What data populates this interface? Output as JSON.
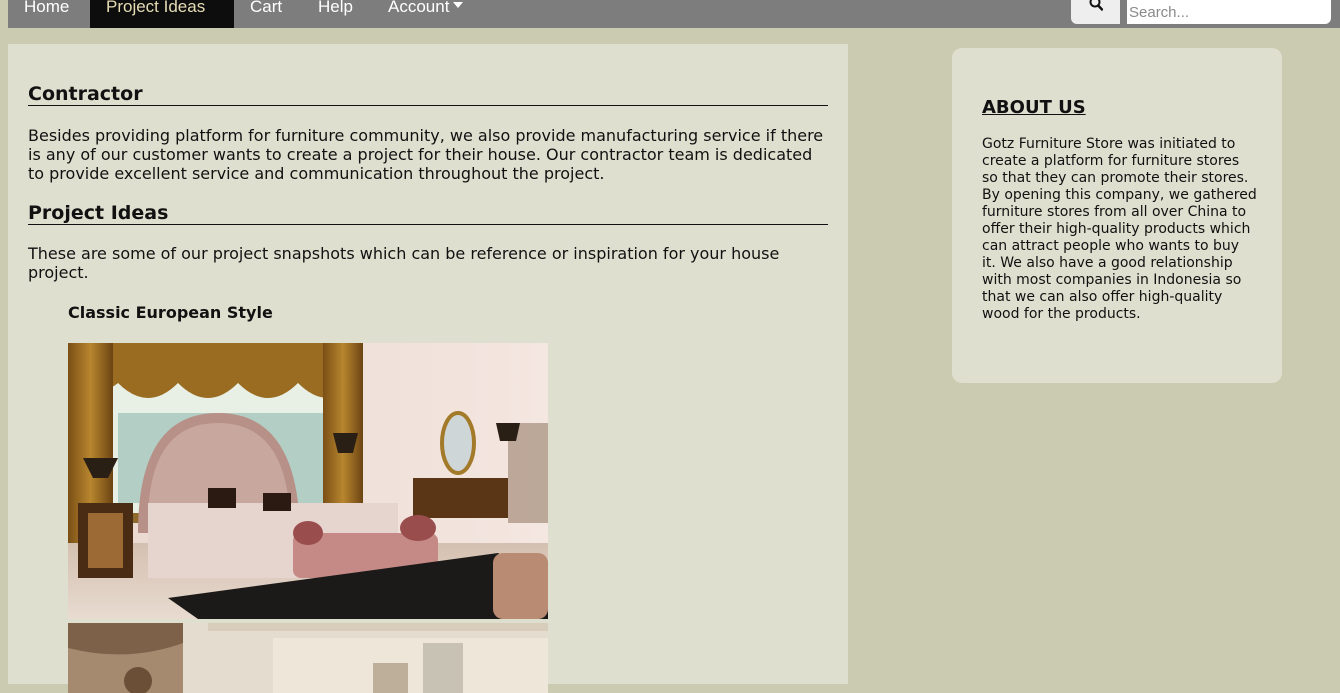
{
  "nav": {
    "items": [
      {
        "label": "Home"
      },
      {
        "label": "Project Ideas"
      },
      {
        "label": "Cart"
      },
      {
        "label": "Help"
      },
      {
        "label": "Account"
      }
    ],
    "search_placeholder": "Search..."
  },
  "main": {
    "contractor_title": "Contractor",
    "contractor_text": "Besides providing platform for furniture community, we also provide manufacturing service if there is any of our customer wants to create a project for their house. Our contractor team is dedicated to provide excellent service and communication throughout the project.",
    "ideas_title": "Project Ideas",
    "ideas_text": "These are some of our project snapshots which can be reference or inspiration for your house project.",
    "style_title": "Classic European Style"
  },
  "aside": {
    "title": "ABOUT US",
    "text": "Gotz Furniture Store was initiated to create a platform for furniture stores so that they can promote their stores. By opening this company, we gathered furniture stores from all over China to offer their high-quality products which can attract people who wants to buy it. We also have a good relationship with most companies in Indonesia so that we can also offer high-quality wood for the products."
  },
  "colors": {
    "background": "#cbcbb1",
    "panel": "#dfdfd0",
    "nav": "#7d7d7d",
    "nav_active": "#0d0d0d"
  }
}
